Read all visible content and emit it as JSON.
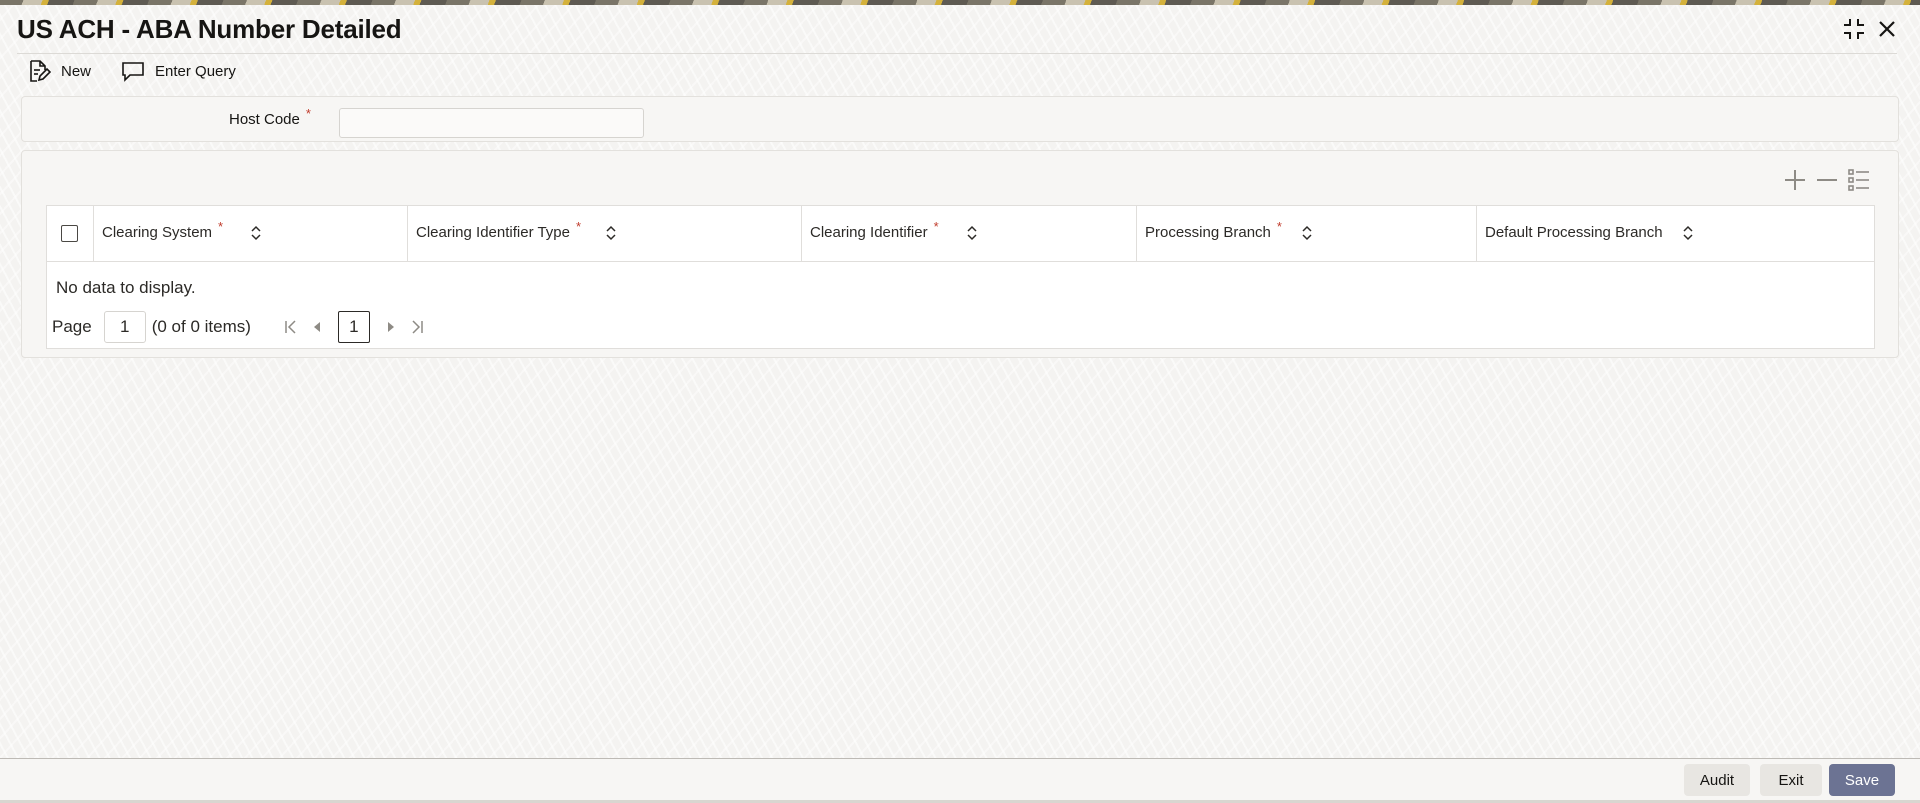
{
  "window": {
    "title": "US ACH - ABA Number Detailed",
    "controls": [
      "collapse-icon",
      "close-icon"
    ]
  },
  "toolbar": {
    "new_label": "New",
    "new_icon": "new-document-icon",
    "query_label": "Enter Query",
    "query_icon": "speech-bubble-icon"
  },
  "form": {
    "host_code": {
      "label": "Host Code",
      "required_mark": "*",
      "value": ""
    }
  },
  "grid": {
    "tools": [
      "add-row-icon",
      "delete-row-icon",
      "single-record-view-icon"
    ],
    "columns": [
      {
        "label": "Clearing System",
        "required_mark": "*"
      },
      {
        "label": "Clearing Identifier Type",
        "required_mark": "*"
      },
      {
        "label": "Clearing Identifier",
        "required_mark": "*"
      },
      {
        "label": "Processing Branch",
        "required_mark": "*"
      },
      {
        "label": "Default Processing Branch",
        "required_mark": ""
      }
    ],
    "rows": [],
    "empty_message": "No data to display.",
    "pagination": {
      "page_label": "Page",
      "page_input": "1",
      "items_summary": "(0 of 0 items)",
      "current_page": "1"
    }
  },
  "footer": {
    "audit_label": "Audit",
    "exit_label": "Exit",
    "save_label": "Save"
  },
  "colors": {
    "required": "#c03b2b",
    "primary_button": "#6c7393"
  }
}
